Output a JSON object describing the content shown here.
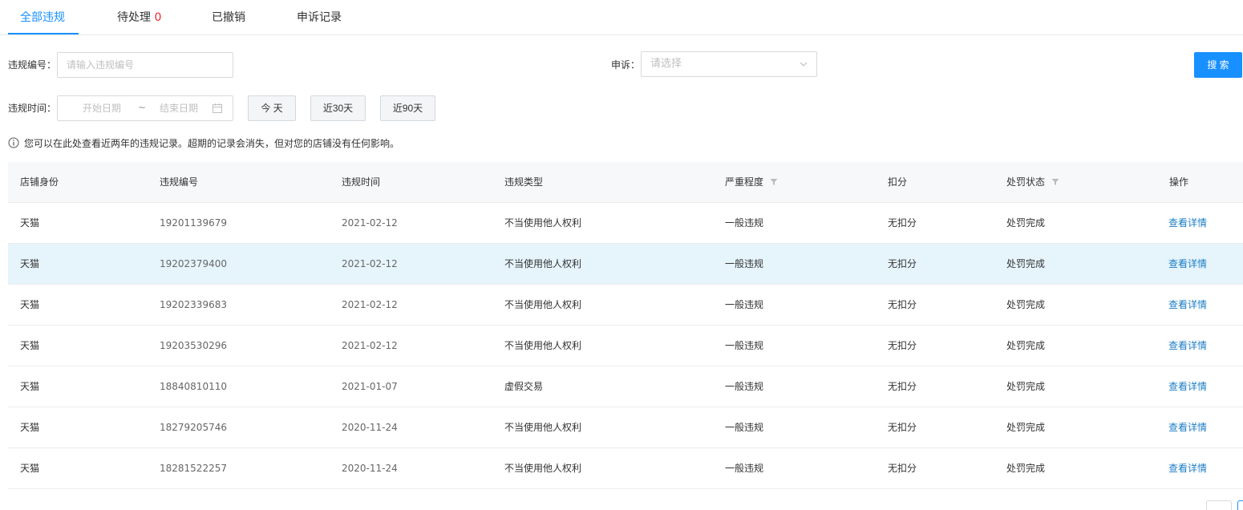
{
  "tabs": [
    {
      "label": "全部违规",
      "count": ""
    },
    {
      "label": "待处理",
      "count": "0"
    },
    {
      "label": "已撤销",
      "count": ""
    },
    {
      "label": "申诉记录",
      "count": ""
    }
  ],
  "form": {
    "violation_no_label": "违规编号：",
    "violation_no_placeholder": "请输入违规编号",
    "appeal_label": "申诉：",
    "appeal_placeholder": "请选择",
    "search_label": "搜 索",
    "time_label": "违规时间：",
    "start_placeholder": "开始日期",
    "range_sep": "~",
    "end_placeholder": "结束日期",
    "today_label": "今 天",
    "last30_label": "近30天",
    "last90_label": "近90天"
  },
  "notice": "您可以在此处查看近两年的违规记录。超期的记录会消失，但对您的店铺没有任何影响。",
  "table": {
    "headers": {
      "identity": "店铺身份",
      "number": "违规编号",
      "time": "违规时间",
      "type": "违规类型",
      "severity": "严重程度",
      "points": "扣分",
      "status": "处罚状态",
      "action": "操作"
    },
    "rows": [
      {
        "identity": "天猫",
        "number": "19201139679",
        "time": "2021-02-12",
        "type": "不当使用他人权利",
        "severity": "一般违规",
        "points": "无扣分",
        "status": "处罚完成",
        "action": "查看详情"
      },
      {
        "identity": "天猫",
        "number": "19202379400",
        "time": "2021-02-12",
        "type": "不当使用他人权利",
        "severity": "一般违规",
        "points": "无扣分",
        "status": "处罚完成",
        "action": "查看详情"
      },
      {
        "identity": "天猫",
        "number": "19202339683",
        "time": "2021-02-12",
        "type": "不当使用他人权利",
        "severity": "一般违规",
        "points": "无扣分",
        "status": "处罚完成",
        "action": "查看详情"
      },
      {
        "identity": "天猫",
        "number": "19203530296",
        "time": "2021-02-12",
        "type": "不当使用他人权利",
        "severity": "一般违规",
        "points": "无扣分",
        "status": "处罚完成",
        "action": "查看详情"
      },
      {
        "identity": "天猫",
        "number": "18840810110",
        "time": "2021-01-07",
        "type": "虚假交易",
        "severity": "一般违规",
        "points": "无扣分",
        "status": "处罚完成",
        "action": "查看详情"
      },
      {
        "identity": "天猫",
        "number": "18279205746",
        "time": "2020-11-24",
        "type": "不当使用他人权利",
        "severity": "一般违规",
        "points": "无扣分",
        "status": "处罚完成",
        "action": "查看详情"
      },
      {
        "identity": "天猫",
        "number": "18281522257",
        "time": "2020-11-24",
        "type": "不当使用他人权利",
        "severity": "一般违规",
        "points": "无扣分",
        "status": "处罚完成",
        "action": "查看详情"
      }
    ]
  },
  "colors": {
    "accent": "#1890ff",
    "link": "#1b7dc6",
    "count": "#f5222d",
    "row_highlight": "#e6f4fc"
  },
  "icons": {
    "notice": "info-circle-icon",
    "date": "calendar-icon",
    "select": "chevron-down-icon",
    "filter": "filter-icon"
  }
}
